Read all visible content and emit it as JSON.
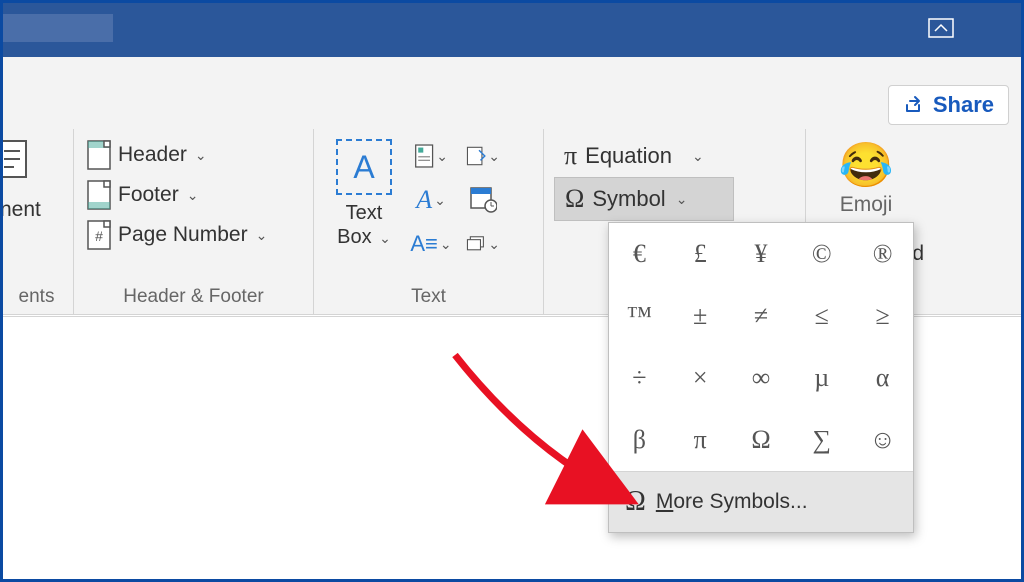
{
  "titlebar": {
    "collapse_tooltip": "Collapse the Ribbon"
  },
  "share": {
    "label": "Share"
  },
  "groups": {
    "comments_label": "ents",
    "comments_partial": "nent",
    "hf_label": "Header & Footer",
    "hf": {
      "header": "Header",
      "footer": "Footer",
      "page_number": "Page Number"
    },
    "text_label": "Text",
    "text": {
      "text_box": "Text\nBox"
    },
    "symbols": {
      "equation": "Equation",
      "symbol": "Symbol"
    },
    "emoji": {
      "label": "Emoji",
      "keyboard_partial": "d"
    }
  },
  "symbol_panel": {
    "grid": [
      "€",
      "£",
      "¥",
      "©",
      "®",
      "™",
      "±",
      "≠",
      "≤",
      "≥",
      "÷",
      "×",
      "∞",
      "µ",
      "α",
      "β",
      "π",
      "Ω",
      "∑",
      "☺"
    ],
    "more": "More Symbols..."
  }
}
